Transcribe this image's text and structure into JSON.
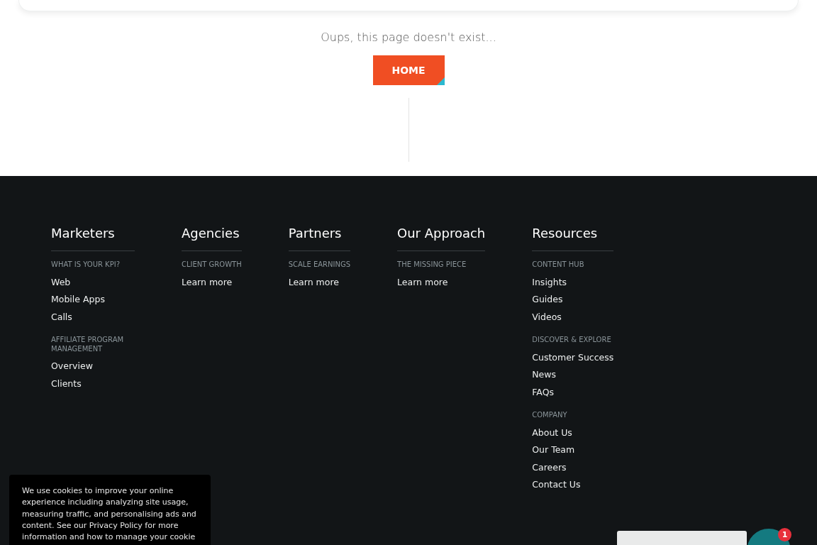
{
  "error_message": "Oups, this page doesn't exist...",
  "home_button": "HOME",
  "footer": {
    "columns": [
      {
        "title": "Marketers",
        "groups": [
          {
            "label": "WHAT IS YOUR KPI?",
            "links": [
              "Web",
              "Mobile Apps",
              "Calls"
            ]
          },
          {
            "label": "AFFILIATE PROGRAM MANAGEMENT",
            "links": [
              "Overview",
              "Clients"
            ]
          }
        ]
      },
      {
        "title": "Agencies",
        "groups": [
          {
            "label": "CLIENT GROWTH",
            "links": [
              "Learn more"
            ]
          }
        ]
      },
      {
        "title": "Partners",
        "groups": [
          {
            "label": "SCALE EARNINGS",
            "links": [
              "Learn more"
            ]
          }
        ]
      },
      {
        "title": "Our Approach",
        "groups": [
          {
            "label": "THE MISSING PIECE",
            "links": [
              "Learn more"
            ]
          }
        ]
      },
      {
        "title": "Resources",
        "groups": [
          {
            "label": "CONTENT HUB",
            "links": [
              "Insights",
              "Guides",
              "Videos"
            ]
          },
          {
            "label": "DISCOVER & EXPLORE",
            "links": [
              "Customer Success",
              "News",
              "FAQs"
            ]
          },
          {
            "label": "COMPANY",
            "links": [
              "About Us",
              "Our Team",
              "Careers",
              "Contact Us"
            ]
          }
        ]
      }
    ]
  },
  "cookie_banner": {
    "text": "We use cookies to improve your online experience including analyzing site usage, measuring traffic, and personalising ads and content. See our Privacy Policy for more information and how to manage your cookie"
  },
  "chat": {
    "badge": "1"
  }
}
